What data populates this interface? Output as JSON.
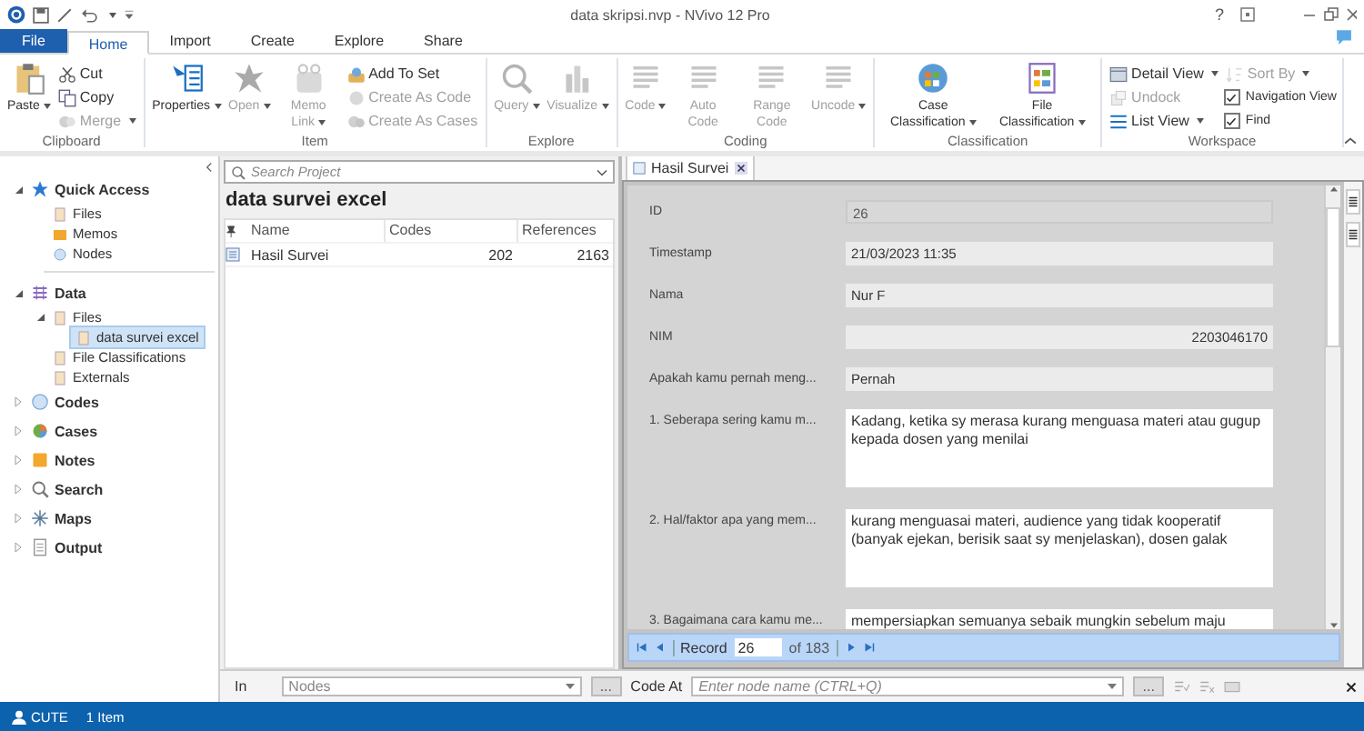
{
  "window": {
    "title": "data skripsi.nvp - NVivo 12 Pro",
    "help": "?"
  },
  "menu_tabs": [
    {
      "label": "File",
      "kind": "file",
      "selected": false
    },
    {
      "label": "Home",
      "kind": "tab",
      "selected": true
    },
    {
      "label": "Import",
      "kind": "tab",
      "selected": false
    },
    {
      "label": "Create",
      "kind": "tab",
      "selected": false
    },
    {
      "label": "Explore",
      "kind": "tab",
      "selected": false
    },
    {
      "label": "Share",
      "kind": "tab",
      "selected": false
    }
  ],
  "ribbon": [
    {
      "label": "Clipboard",
      "items": [
        {
          "label": "Paste",
          "kind": "large",
          "dropdown": true,
          "disabled": false
        },
        {
          "label": "Cut",
          "kind": "small",
          "dropdown": false,
          "disabled": false
        },
        {
          "label": "Copy",
          "kind": "small",
          "dropdown": false,
          "disabled": false
        },
        {
          "label": "Merge",
          "kind": "small",
          "dropdown": true,
          "disabled": true
        }
      ]
    },
    {
      "label": "Item",
      "items": [
        {
          "label": "Properties",
          "kind": "large",
          "dropdown": true,
          "disabled": false
        },
        {
          "label": "Open",
          "kind": "large",
          "dropdown": true,
          "disabled": true
        },
        {
          "label": "Memo Link",
          "kind": "large",
          "dropdown": true,
          "disabled": true
        },
        {
          "label": "Add To Set",
          "kind": "small",
          "dropdown": false,
          "disabled": false
        },
        {
          "label": "Create As Code",
          "kind": "small",
          "dropdown": false,
          "disabled": true
        },
        {
          "label": "Create As Cases",
          "kind": "small",
          "dropdown": false,
          "disabled": true
        }
      ]
    },
    {
      "label": "Explore",
      "items": [
        {
          "label": "Query",
          "kind": "large",
          "dropdown": true,
          "disabled": true
        },
        {
          "label": "Visualize",
          "kind": "large",
          "dropdown": true,
          "disabled": true
        }
      ]
    },
    {
      "label": "Coding",
      "items": [
        {
          "label": "Code",
          "kind": "large",
          "dropdown": true,
          "disabled": true
        },
        {
          "label": "Auto Code",
          "kind": "large",
          "dropdown": false,
          "disabled": true
        },
        {
          "label": "Range Code",
          "kind": "large",
          "dropdown": false,
          "disabled": true
        },
        {
          "label": "Uncode",
          "kind": "large",
          "dropdown": true,
          "disabled": true
        }
      ]
    },
    {
      "label": "Classification",
      "items": [
        {
          "label": "Case Classification",
          "kind": "large",
          "dropdown": true,
          "disabled": false
        },
        {
          "label": "File Classification",
          "kind": "large",
          "dropdown": true,
          "disabled": false
        }
      ]
    },
    {
      "label": "Workspace",
      "items": [
        {
          "label": "Detail View",
          "kind": "small",
          "dropdown": true,
          "disabled": false
        },
        {
          "label": "Undock",
          "kind": "small",
          "dropdown": false,
          "disabled": true
        },
        {
          "label": "List View",
          "kind": "small",
          "dropdown": true,
          "disabled": false
        },
        {
          "label": "Sort By",
          "kind": "small",
          "dropdown": true,
          "disabled": true
        },
        {
          "label": "Navigation View",
          "kind": "check",
          "checked": true,
          "disabled": false
        },
        {
          "label": "Find",
          "kind": "check",
          "checked": true,
          "disabled": false
        }
      ]
    }
  ],
  "navigation": [
    {
      "label": "Quick Access",
      "expanded": true,
      "selected": false,
      "children": [
        {
          "label": "Files",
          "selected": false
        },
        {
          "label": "Memos",
          "selected": false
        },
        {
          "label": "Nodes",
          "selected": false
        }
      ]
    },
    {
      "label": "Data",
      "expanded": true,
      "selected": false,
      "children": [
        {
          "label": "Files",
          "expanded": true,
          "selected": false,
          "children": [
            {
              "label": "data survei excel",
              "selected": true
            }
          ]
        },
        {
          "label": "File Classifications",
          "selected": false
        },
        {
          "label": "Externals",
          "selected": false
        }
      ]
    },
    {
      "label": "Codes",
      "expanded": false,
      "selected": false
    },
    {
      "label": "Cases",
      "expanded": false,
      "selected": false
    },
    {
      "label": "Notes",
      "expanded": false,
      "selected": false
    },
    {
      "label": "Search",
      "expanded": false,
      "selected": false
    },
    {
      "label": "Maps",
      "expanded": false,
      "selected": false
    },
    {
      "label": "Output",
      "expanded": false,
      "selected": false
    }
  ],
  "list_view": {
    "search": {
      "placeholder": "Search Project"
    },
    "title": "data survei excel",
    "columns": [
      "Name",
      "Codes",
      "References"
    ],
    "rows": [
      {
        "name": "Hasil Survei",
        "codes": "202",
        "references": "2163"
      }
    ]
  },
  "detail": {
    "tab": "Hasil Survei",
    "fields": [
      {
        "label": "ID",
        "value": "26",
        "kind": "readonly"
      },
      {
        "label": "Timestamp",
        "value": "21/03/2023 11:35",
        "kind": "text"
      },
      {
        "label": "Nama",
        "value": "Nur F",
        "kind": "text"
      },
      {
        "label": "NIM",
        "value": "2203046170",
        "kind": "number"
      },
      {
        "label": "Apakah kamu pernah meng...",
        "value": "Pernah",
        "kind": "text"
      },
      {
        "label": "1. Seberapa sering kamu m...",
        "value": "Kadang, ketika sy merasa kurang menguasa materi atau gugup kepada dosen yang menilai",
        "kind": "memo"
      },
      {
        "label": "2. Hal/faktor apa yang mem...",
        "value": "kurang menguasai materi, audience yang tidak kooperatif (banyak ejekan, berisik saat sy menjelaskan), dosen galak",
        "kind": "memo"
      },
      {
        "label": "3. Bagaimana cara kamu me...",
        "value": "mempersiapkan semuanya sebaik mungkin sebelum maju",
        "kind": "memo"
      }
    ],
    "record": {
      "label": "Record",
      "value": "26",
      "total": "of 183"
    }
  },
  "code_bar": {
    "in_label": "In",
    "in_value": "Nodes",
    "in_button": "...",
    "code_at_label": "Code At",
    "placeholder": "Enter node name (CTRL+Q)",
    "code_at_button": "..."
  },
  "status_bar": {
    "user": "CUTE",
    "count": "1 Item"
  }
}
